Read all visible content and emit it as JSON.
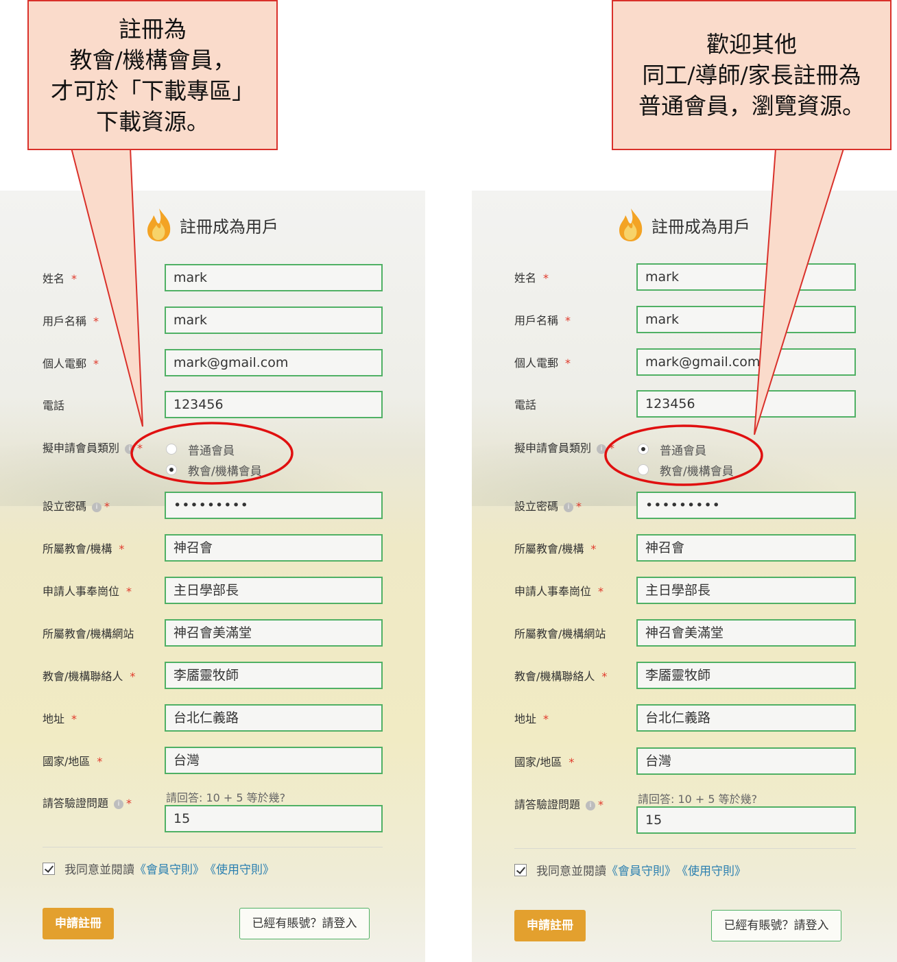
{
  "callouts": {
    "left": [
      "註冊為",
      "教會/機構會員，",
      "才可於「下載專區」",
      "下載資源。"
    ],
    "right": [
      "歡迎其他",
      "同工/導師/家長註冊為",
      "普通會員，瀏覽資源。"
    ]
  },
  "form": {
    "title": "註冊成為用戶",
    "required_mark": "*",
    "info_glyph": "i",
    "labels": {
      "name": "姓名",
      "username": "用戶名稱",
      "email": "個人電郵",
      "phone": "電話",
      "member_type": "擬申請會員類別",
      "password": "設立密碼",
      "church": "所屬教會/機構",
      "position": "申請人事奉崗位",
      "website": "所屬教會/機構網站",
      "contact": "教會/機構聯絡人",
      "address": "地址",
      "country": "國家/地區",
      "captcha": "請答驗證問題"
    },
    "values": {
      "name": "mark",
      "username": "mark",
      "email": "mark@gmail.com",
      "phone": "123456",
      "password": "•••••••••",
      "church": "神召會",
      "position": "主日學部長",
      "website": "神召會美滿堂",
      "contact": "李靥靈牧師",
      "address": "台北仁義路",
      "country": "台灣",
      "captcha_answer": "15"
    },
    "captcha_hint": "請回答: 10 + 5 等於幾?",
    "member_options": [
      "普通會員",
      "教會/機構會員"
    ],
    "agree": {
      "text": "我同意並閱讀",
      "link1": "《會員守則》",
      "link2": "《使用守則》",
      "checked": true
    },
    "submit_label": "申請註冊",
    "login_label": "已經有賬號？請登入"
  },
  "panels": {
    "left": {
      "selected_member_type": "教會/機構會員"
    },
    "right": {
      "selected_member_type": "普通會員"
    }
  },
  "colors": {
    "field_border": "#4fb064",
    "submit_bg": "#e3a02e",
    "link": "#2a7fb0",
    "required": "#e0382a",
    "callout_fill": "#fadbcb",
    "callout_border": "#d9302a",
    "highlight_ellipse": "#e01010"
  }
}
